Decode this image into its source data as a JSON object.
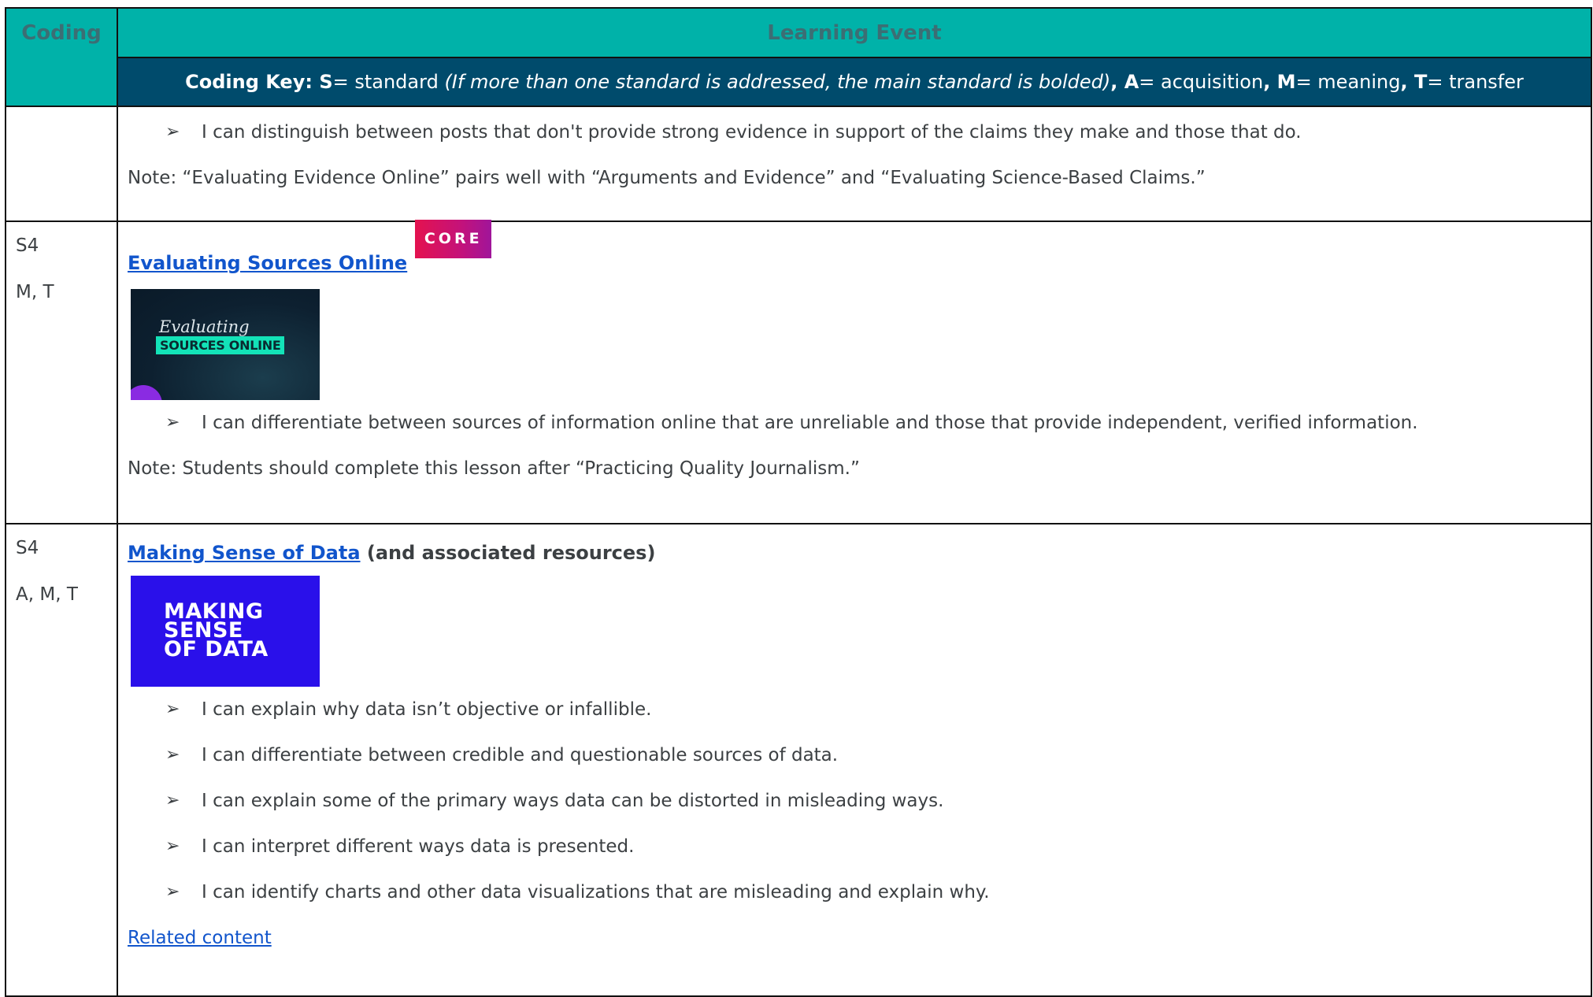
{
  "header": {
    "coding_label": "Coding",
    "learning_event_label": "Learning Event",
    "key_prefix": "Coding Key: ",
    "key_s": "S",
    "key_s_text": "= standard ",
    "key_note": "(If more than one standard is addressed, the main standard is bolded)",
    "key_sep1": ", ",
    "key_a": "A",
    "key_a_text": "= acquisition",
    "key_sep2": ", ",
    "key_m": "M",
    "key_m_text": "= meaning",
    "key_sep3": ", ",
    "key_t": "T",
    "key_t_text": "= transfer"
  },
  "rows": [
    {
      "bullets": [
        "I can distinguish between posts that don't provide strong evidence in support of the claims they make and those that do."
      ],
      "note": "Note: “Evaluating Evidence Online” pairs well with “Arguments and Evidence” and “Evaluating Science-Based Claims.”"
    },
    {
      "code_standard": "S4",
      "code_levels": "M, T",
      "title": "Evaluating Sources Online",
      "badge": "CORE",
      "thumb_line1": "Evaluating",
      "thumb_line2": "SOURCES ONLINE",
      "bullets": [
        "I can differentiate between sources of information online that are unreliable and those that provide independent, verified information."
      ],
      "note": "Note: Students should complete this lesson after “Practicing Quality Journalism.”"
    },
    {
      "code_standard": "S4",
      "code_levels": "A, M, T",
      "title": "Making Sense of Data",
      "title_suffix": " (and associated resources)",
      "thumb_line1": "MAKING",
      "thumb_line2": "SENSE",
      "thumb_line3": "OF DATA",
      "bullets": [
        "I can explain why data isn’t objective or infallible.",
        "I can differentiate between credible and questionable sources of data.",
        "I can explain some of the primary ways data can be distorted in misleading ways.",
        "I can interpret different ways data is presented.",
        "I can identify charts and other data visualizations that are misleading and explain why."
      ],
      "related": "Related content"
    }
  ],
  "bullet_glyph": "➢",
  "colors": {
    "header_teal": "#00b2a9",
    "key_navy": "#004b6c",
    "link_blue": "#1155cc",
    "core_badge": "#e4124f",
    "making_sense_bg": "#2a10ea"
  }
}
